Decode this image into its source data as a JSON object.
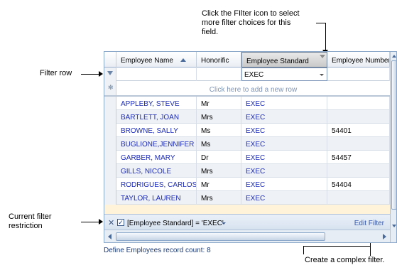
{
  "annotations": {
    "filter_icon_callout": [
      "Click the FIlter icon to select",
      "more filter choices for this",
      "field."
    ],
    "filter_row_label": "Filter row",
    "current_filter_label": [
      "Current filter",
      "restriction"
    ],
    "complex_filter_label": "Create a complex filter."
  },
  "grid": {
    "columns": [
      "Employee Name",
      "Honorific",
      "Employee Standard",
      "Employee Number"
    ],
    "filter_value": "EXEC",
    "new_row_text": "Click here to add a new row",
    "rows": [
      [
        "APPLEBY, STEVE",
        "Mr",
        "EXEC",
        ""
      ],
      [
        "BARTLETT, JOAN",
        "Mrs",
        "EXEC",
        ""
      ],
      [
        "BROWNE, SALLY",
        "Ms",
        "EXEC",
        "54401"
      ],
      [
        "BUGLIONE,JENNIFER",
        "Ms",
        "EXEC",
        ""
      ],
      [
        "GARBER, MARY",
        "Dr",
        "EXEC",
        "54457"
      ],
      [
        "GILLS, NICOLE",
        "Mrs",
        "EXEC",
        ""
      ],
      [
        "RODRIGUES, CARLOS",
        "Mr",
        "EXEC",
        "54404"
      ],
      [
        "TAYLOR, LAUREN",
        "Mrs",
        "EXEC",
        ""
      ]
    ],
    "filter_expression": "[Employee Standard] = 'EXEC'",
    "edit_filter_label": "Edit Filter",
    "sorted_column": "Employee Name",
    "sort_direction": "ascending",
    "filter_enabled": true
  },
  "status": {
    "record_count": "Define Employees record count: 8"
  },
  "icons": {
    "filter_row_indicator": "funnel-icon",
    "new_row_indicator": "asterisk-icon",
    "clear_filter": "close-icon",
    "filter_checkbox": "checkbox-checked-icon",
    "sort_indicator": "sort-ascending-icon"
  },
  "colors": {
    "link_blue": "#1c2bb8",
    "grid_border": "#8aa7c9",
    "alt_row": "#eef1f6",
    "group_band": "#fff4d9"
  }
}
